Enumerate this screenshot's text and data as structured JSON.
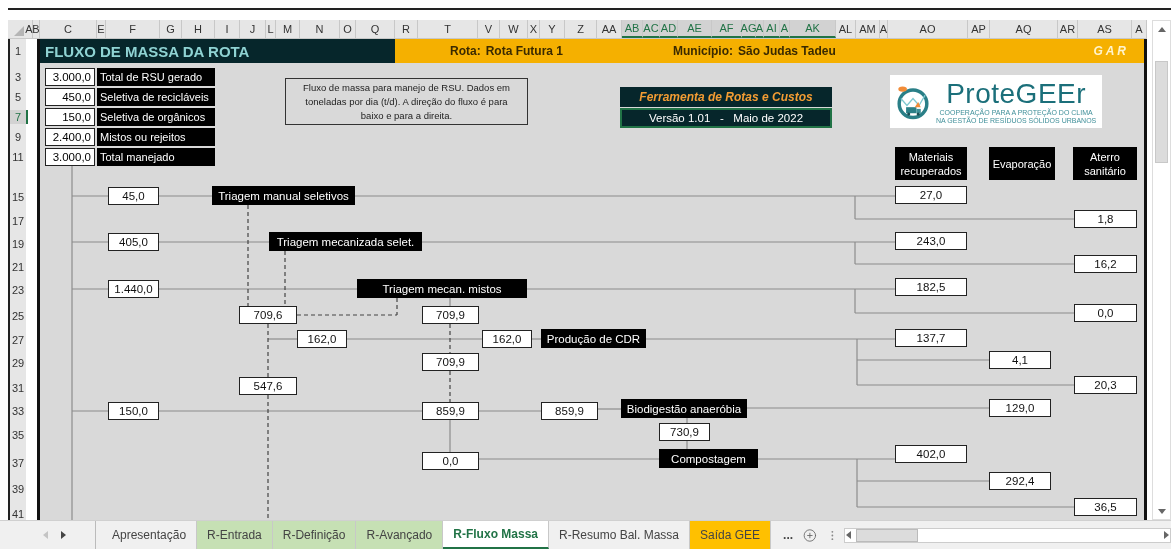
{
  "column_headers": [
    {
      "label": "A",
      "selected": false
    },
    {
      "label": "B",
      "selected": false
    },
    {
      "label": "C",
      "selected": false
    },
    {
      "label": "E",
      "selected": false
    },
    {
      "label": "F",
      "selected": false
    },
    {
      "label": "G",
      "selected": false
    },
    {
      "label": "H",
      "selected": false
    },
    {
      "label": "I",
      "selected": false
    },
    {
      "label": "J",
      "selected": false
    },
    {
      "label": "L",
      "selected": false
    },
    {
      "label": "M",
      "selected": false
    },
    {
      "label": "N",
      "selected": false
    },
    {
      "label": "O",
      "selected": false
    },
    {
      "label": "Q",
      "selected": false
    },
    {
      "label": "R",
      "selected": false
    },
    {
      "label": "T",
      "selected": false
    },
    {
      "label": "V",
      "selected": false
    },
    {
      "label": "W",
      "selected": false
    },
    {
      "label": "X",
      "selected": false
    },
    {
      "label": "Y",
      "selected": false
    },
    {
      "label": "Z",
      "selected": false
    },
    {
      "label": "AA",
      "selected": false
    },
    {
      "label": "AB",
      "selected": true
    },
    {
      "label": "AC",
      "selected": true
    },
    {
      "label": "AD",
      "selected": true
    },
    {
      "label": "AE",
      "selected": true
    },
    {
      "label": "AF",
      "selected": true
    },
    {
      "label": "AG",
      "selected": true
    },
    {
      "label": "A",
      "selected": true
    },
    {
      "label": "AI",
      "selected": true
    },
    {
      "label": "A",
      "selected": true
    },
    {
      "label": "AK",
      "selected": true
    },
    {
      "label": "AL",
      "selected": false
    },
    {
      "label": "AM",
      "selected": false
    },
    {
      "label": "A",
      "selected": false
    },
    {
      "label": "AO",
      "selected": false
    },
    {
      "label": "AP",
      "selected": false
    },
    {
      "label": "AQ",
      "selected": false
    },
    {
      "label": "AR",
      "selected": false
    },
    {
      "label": "AS",
      "selected": false
    },
    {
      "label": "A",
      "selected": false
    }
  ],
  "row_headers": [
    {
      "label": "1",
      "selected": false
    },
    {
      "label": "3",
      "selected": false
    },
    {
      "label": "5",
      "selected": false
    },
    {
      "label": "7",
      "selected": true
    },
    {
      "label": "9",
      "selected": false
    },
    {
      "label": "11",
      "selected": false
    },
    {
      "label": "15",
      "selected": false
    },
    {
      "label": "17",
      "selected": false
    },
    {
      "label": "19",
      "selected": false
    },
    {
      "label": "21",
      "selected": false
    },
    {
      "label": "23",
      "selected": false
    },
    {
      "label": "25",
      "selected": false
    },
    {
      "label": "27",
      "selected": false
    },
    {
      "label": "29",
      "selected": false
    },
    {
      "label": "31",
      "selected": false
    },
    {
      "label": "33",
      "selected": false
    },
    {
      "label": "35",
      "selected": false
    },
    {
      "label": "37",
      "selected": false
    },
    {
      "label": "39",
      "selected": false
    },
    {
      "label": "41",
      "selected": false
    }
  ],
  "header": {
    "title": "FLUXO DE MASSA DA ROTA",
    "route_label": "Rota:",
    "route_value": "Rota Futura 1",
    "municipality_label": "Município:",
    "municipality_value": "São Judas Tadeu",
    "badge": "G A R"
  },
  "inputs": [
    {
      "amount": "3.000,0",
      "name": "Total de RSU gerado"
    },
    {
      "amount": "450,0",
      "name": "Seletiva de recicláveis"
    },
    {
      "amount": "150,0",
      "name": "Seletiva de orgânicos"
    },
    {
      "amount": "2.400,0",
      "name": "Mistos ou rejeitos"
    },
    {
      "amount": "3.000,0",
      "name": "Total manejado"
    }
  ],
  "note": "Fluxo de massa para manejo de RSU. Dados em toneladas por dia (t/d). A direção do fluxo é para baixo e para a direita.",
  "tool": {
    "title": "Ferramenta de Rotas e Custos",
    "version": "Versão 1.01   -   Maio de 2022",
    "selected": true
  },
  "logo": {
    "wordmark": "ProteGEEr",
    "tagline": [
      "COOPERAÇÃO PARA A PROTEÇÃO DO CLIMA",
      "NA GESTÃO DE RESÍDUOS SÓLIDOS URBANOS"
    ]
  },
  "output_headers": [
    "Materiais recuperados",
    "Evaporação",
    "Aterro sanitário"
  ],
  "processes": [
    "Triagem manual seletivos",
    "Triagem mecanizada selet.",
    "Triagem mecan. mistos",
    "Produção de CDR",
    "Biodigestão anaeróbia",
    "Compostagem"
  ],
  "flows": [
    "45,0",
    "405,0",
    "1.440,0",
    "709,6",
    "162,0",
    "547,6",
    "150,0",
    "709,9",
    "709,9",
    "859,9",
    "0,0",
    "162,0",
    "859,9",
    "730,9",
    "27,0",
    "1,8",
    "243,0",
    "16,2",
    "182,5",
    "0,0",
    "137,7",
    "4,1",
    "20,3",
    "129,0",
    "402,0",
    "292,4",
    "36,5"
  ],
  "sheet_tabs": [
    {
      "label": "Apresentação",
      "selected": false,
      "color": "#f0f0f0"
    },
    {
      "label": "R-Entrada",
      "selected": false,
      "color": "#c6e0b4"
    },
    {
      "label": "R-Definição",
      "selected": false,
      "color": "#c6e0b4"
    },
    {
      "label": "R-Avançado",
      "selected": false,
      "color": "#c6e0b4"
    },
    {
      "label": "R-Fluxo Massa",
      "selected": true,
      "color": "#ffffff"
    },
    {
      "label": "R-Resumo Bal. Massa",
      "selected": false,
      "color": "#f0f0f0"
    },
    {
      "label": "Saída GEE",
      "selected": false,
      "color": "#ffc000"
    }
  ],
  "more_tabs": "..."
}
